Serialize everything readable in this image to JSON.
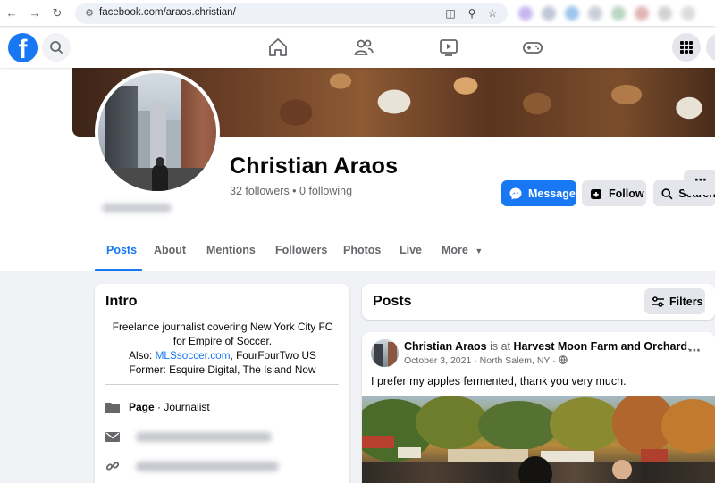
{
  "browser": {
    "url": "facebook.com/araos.christian/"
  },
  "profile": {
    "name": "Christian Araos",
    "stats": "32 followers • 0 following",
    "buttons": {
      "message": "Message",
      "follow": "Follow",
      "search": "Search"
    },
    "tabs": [
      "Posts",
      "About",
      "Mentions",
      "Followers",
      "Photos",
      "Live",
      "More"
    ],
    "active_tab": "Posts"
  },
  "intro": {
    "title": "Intro",
    "bio_line1": "Freelance journalist covering New York City FC",
    "bio_line2": "for Empire of Soccer.",
    "bio_also_prefix": "Also: ",
    "bio_link": "MLSsoccer.com",
    "bio_also_suffix": ", FourFourTwo US",
    "bio_line4": "Former: Esquire Digital, The Island Now",
    "page_label": "Page",
    "page_category": " · Journalist"
  },
  "posts_section": {
    "title": "Posts",
    "filters_label": "Filters"
  },
  "post": {
    "author": "Christian Araos",
    "connector": " is at ",
    "place": "Harvest Moon Farm and Orchard",
    "place_suffix": ".",
    "date": "October 3, 2021",
    "location": "North Salem, NY",
    "text": "I prefer my apples fermented, thank you very much."
  },
  "colors": {
    "brand": "#1877f2",
    "background": "#f0f2f5"
  }
}
